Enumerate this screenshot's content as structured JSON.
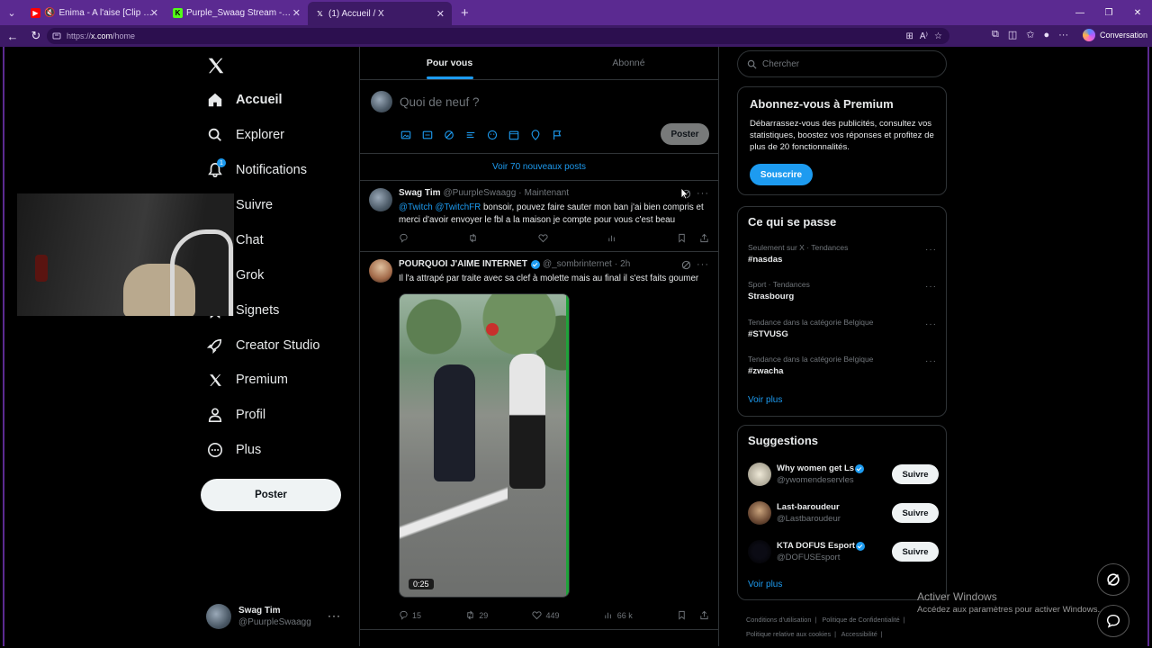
{
  "browser": {
    "tabs": [
      {
        "title": "Enima - A l'aise [Clip Officiel]",
        "favicon": "youtube-icon"
      },
      {
        "title": "Purple_Swaag Stream - Watch Live",
        "favicon": "kick-icon"
      },
      {
        "title": "(1) Accueil / X",
        "favicon": "x-icon",
        "active": true
      }
    ],
    "url_scheme": "https://",
    "url_domain": "x.com",
    "url_path": "/home",
    "copilot_label": "Conversation"
  },
  "nav": {
    "items": [
      {
        "label": "Accueil",
        "icon": "home-icon",
        "bold": true
      },
      {
        "label": "Explorer",
        "icon": "search-icon"
      },
      {
        "label": "Notifications",
        "icon": "bell-icon",
        "badge": "1"
      },
      {
        "label": "Suivre",
        "icon": "people-icon"
      },
      {
        "label": "Chat",
        "icon": "chat-icon"
      },
      {
        "label": "Grok",
        "icon": "grok-icon"
      },
      {
        "label": "Signets",
        "icon": "bookmark-icon"
      },
      {
        "label": "Creator Studio",
        "icon": "rocket-icon"
      },
      {
        "label": "Premium",
        "icon": "x-icon"
      },
      {
        "label": "Profil",
        "icon": "person-icon"
      },
      {
        "label": "Plus",
        "icon": "more-circle-icon"
      }
    ],
    "post_button": "Poster",
    "account": {
      "name": "Swag Tim",
      "handle": "@PuurpleSwaagg"
    }
  },
  "feed": {
    "tabs": [
      "Pour vous",
      "Abonné"
    ],
    "compose_placeholder": "Quoi de neuf ?",
    "compose_post_button": "Poster",
    "new_posts": "Voir 70 nouveaux posts",
    "tweets": [
      {
        "name": "Swag Tim",
        "handle": "@PuurpleSwaagg",
        "time": "Maintenant",
        "mention1": "@Twitch",
        "mention2": "@TwitchFR",
        "text": "bonsoir, pouvez faire sauter mon ban j'ai bien compris et merci d'avoir envoyer le fbl a la maison je compte pour vous c'est beau"
      },
      {
        "name": "POURQUOI J'AIME INTERNET",
        "handle": "@_sombrinternet",
        "time": "2h",
        "verified": true,
        "text": "Il l'a attrapé par traite avec sa clef à molette mais au final il s'est faits goumer",
        "video_duration": "0:25",
        "replies": "15",
        "reposts": "29",
        "likes": "449",
        "views": "66 k"
      }
    ]
  },
  "sidebar": {
    "search_placeholder": "Chercher",
    "premium": {
      "title": "Abonnez-vous à Premium",
      "desc": "Débarrassez-vous des publicités, consultez vos statistiques, boostez vos réponses et profitez de plus de 20 fonctionnalités.",
      "button": "Souscrire"
    },
    "trends": {
      "title": "Ce qui se passe",
      "items": [
        {
          "cat": "Seulement sur X · Tendances",
          "tag": "#nasdas"
        },
        {
          "cat": "Sport · Tendances",
          "tag": "Strasbourg"
        },
        {
          "cat": "Tendance dans la catégorie Belgique",
          "tag": "#STVUSG"
        },
        {
          "cat": "Tendance dans la catégorie Belgique",
          "tag": "#zwacha"
        }
      ],
      "see_more": "Voir plus"
    },
    "suggestions": {
      "title": "Suggestions",
      "items": [
        {
          "name": "Why women get Ls",
          "handle": "@ywomendeservles",
          "verified": true
        },
        {
          "name": "Last-baroudeur",
          "handle": "@Lastbaroudeur",
          "verified": false
        },
        {
          "name": "KTA DOFUS Esport",
          "handle": "@DOFUSEsport",
          "verified": true
        }
      ],
      "follow": "Suivre",
      "see_more": "Voir plus"
    },
    "footer": {
      "l1": "Conditions d'utilisation",
      "l2": "Politique de Confidentialité",
      "l3": "Politique relative aux cookies",
      "l4": "Accessibilité"
    }
  },
  "windows": {
    "title": "Activer Windows",
    "sub": "Accédez aux paramètres pour activer Windows."
  },
  "colors": {
    "accent": "#1d9bf0",
    "browser": "#5b2a91"
  }
}
